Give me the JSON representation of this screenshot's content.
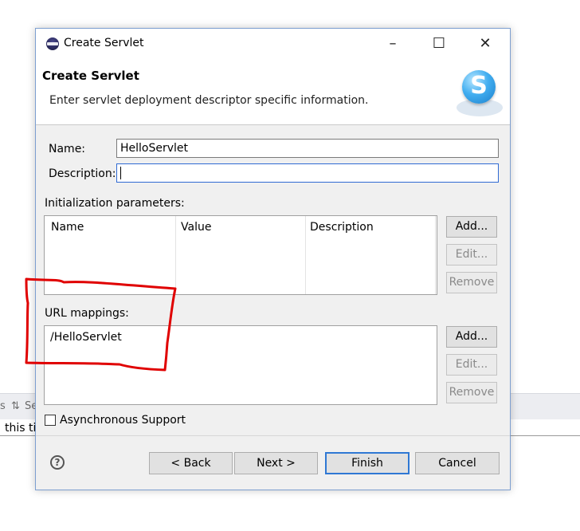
{
  "background": {
    "tab_labels": [
      "s",
      "Se"
    ],
    "text_fragment": "this ti"
  },
  "window": {
    "title": "Create Servlet",
    "minimize": "–",
    "maximize": "☐",
    "close": "✕"
  },
  "banner": {
    "title": "Create Servlet",
    "description": "Enter servlet deployment descriptor specific information.",
    "logo_letter": "S"
  },
  "form": {
    "name_label": "Name:",
    "name_value": "HelloServlet",
    "description_label": "Description:",
    "description_value": ""
  },
  "init_params": {
    "label": "Initialization parameters:",
    "columns": [
      "Name",
      "Value",
      "Description"
    ],
    "rows": [],
    "buttons": {
      "add": "Add...",
      "edit": "Edit...",
      "remove": "Remove"
    }
  },
  "url_mappings": {
    "label": "URL mappings:",
    "items": [
      "/HelloServlet"
    ],
    "buttons": {
      "add": "Add...",
      "edit": "Edit...",
      "remove": "Remove"
    }
  },
  "async": {
    "label": "Asynchronous Support",
    "checked": false
  },
  "footer": {
    "help": "?",
    "back": "< Back",
    "next": "Next >",
    "finish": "Finish",
    "cancel": "Cancel"
  },
  "colors": {
    "accent": "#2f78d4",
    "annotation": "#e00000",
    "dialog_bg": "#f0f0f0"
  }
}
